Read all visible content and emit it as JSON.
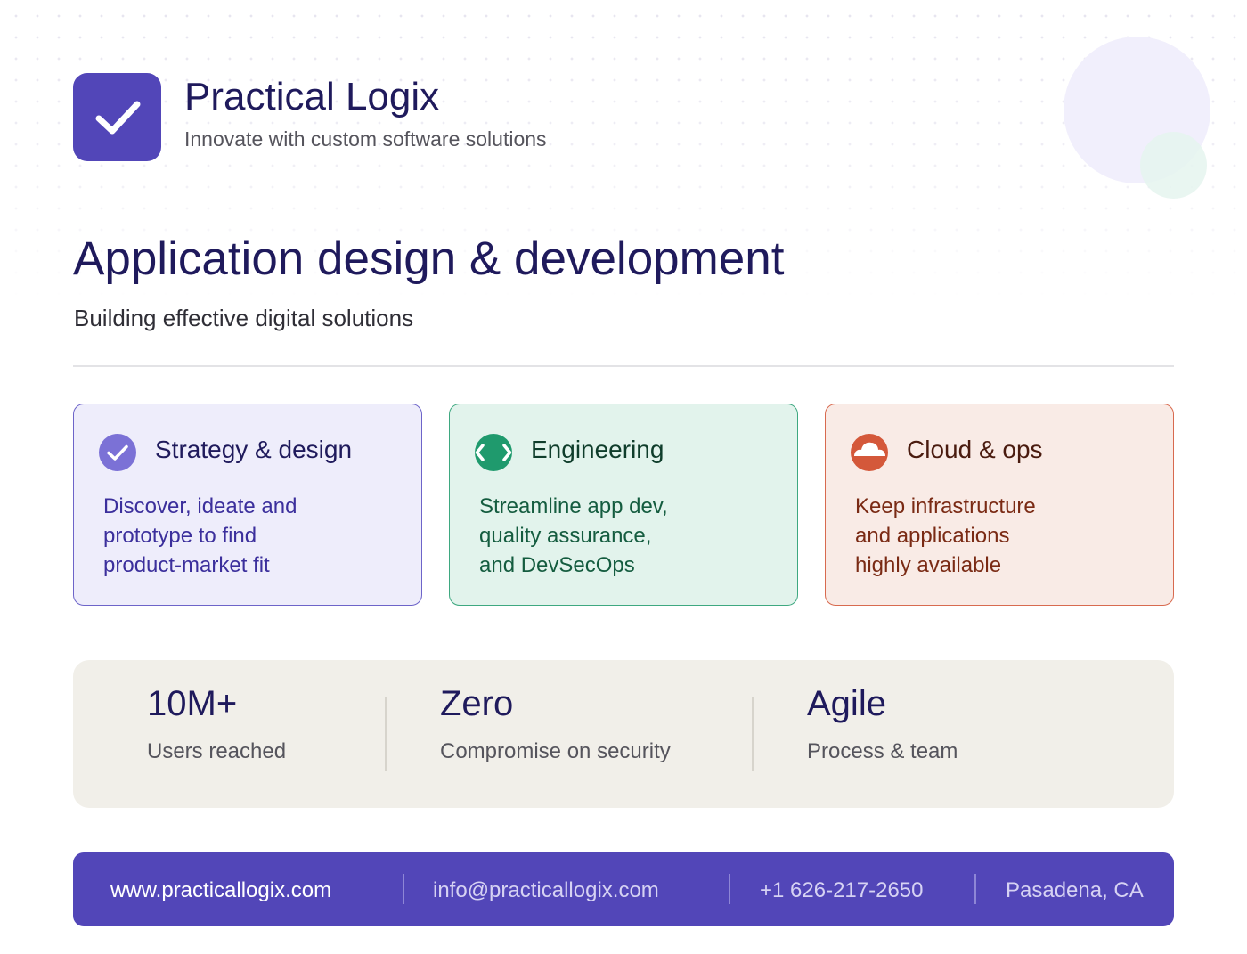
{
  "brand": {
    "name": "Practical Logix",
    "tagline": "Innovate with custom software solutions",
    "logo_icon": "checkmark-icon",
    "color": "#5246b8"
  },
  "hero": {
    "title": "Application design & development",
    "subtitle": "Building effective digital solutions"
  },
  "cards": [
    {
      "title": "Strategy & design",
      "icon": "check-circle-icon",
      "lines": [
        "Discover, ideate and",
        "prototype to find",
        "product-market fit"
      ],
      "accent": "#6d64c9"
    },
    {
      "title": "Engineering",
      "icon": "code-brackets-icon",
      "lines": [
        "Streamline app dev,",
        "quality assurance,",
        "and DevSecOps"
      ],
      "accent": "#1f9a6d"
    },
    {
      "title": "Cloud & ops",
      "icon": "cloud-icon",
      "lines": [
        "Keep infrastructure",
        "and applications",
        "highly available"
      ],
      "accent": "#d4583a"
    }
  ],
  "stats": [
    {
      "value": "10M+",
      "label": "Users reached"
    },
    {
      "value": "Zero",
      "label": "Compromise on security"
    },
    {
      "value": "Agile",
      "label": "Process & team"
    }
  ],
  "footer": {
    "website": "www.practicallogix.com",
    "email": "info@practicallogix.com",
    "phone": "+1 626-217-2650",
    "location": "Pasadena, CA"
  }
}
